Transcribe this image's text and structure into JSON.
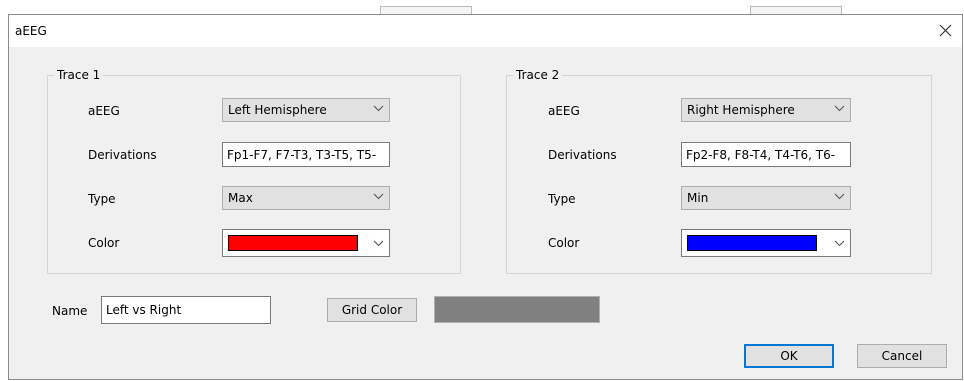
{
  "dialog": {
    "title": "aEEG"
  },
  "trace1": {
    "title": "Trace 1",
    "aeeg_label": "aEEG",
    "aeeg_value": "Left Hemisphere",
    "derivations_label": "Derivations",
    "derivations_value": "Fp1-F7, F7-T3, T3-T5, T5-",
    "type_label": "Type",
    "type_value": "Max",
    "color_label": "Color",
    "color_value": "#ff0000"
  },
  "trace2": {
    "title": "Trace 2",
    "aeeg_label": "aEEG",
    "aeeg_value": "Right Hemisphere",
    "derivations_label": "Derivations",
    "derivations_value": "Fp2-F8, F8-T4, T4-T6, T6-",
    "type_label": "Type",
    "type_value": "Min",
    "color_label": "Color",
    "color_value": "#0000ff"
  },
  "bottom": {
    "name_label": "Name",
    "name_value": "Left vs Right",
    "grid_color_label": "Grid Color",
    "grid_color_value": "#808080",
    "ok_label": "OK",
    "cancel_label": "Cancel"
  },
  "icons": {
    "close": "close-icon",
    "dropdown": "chevron-down-icon"
  }
}
